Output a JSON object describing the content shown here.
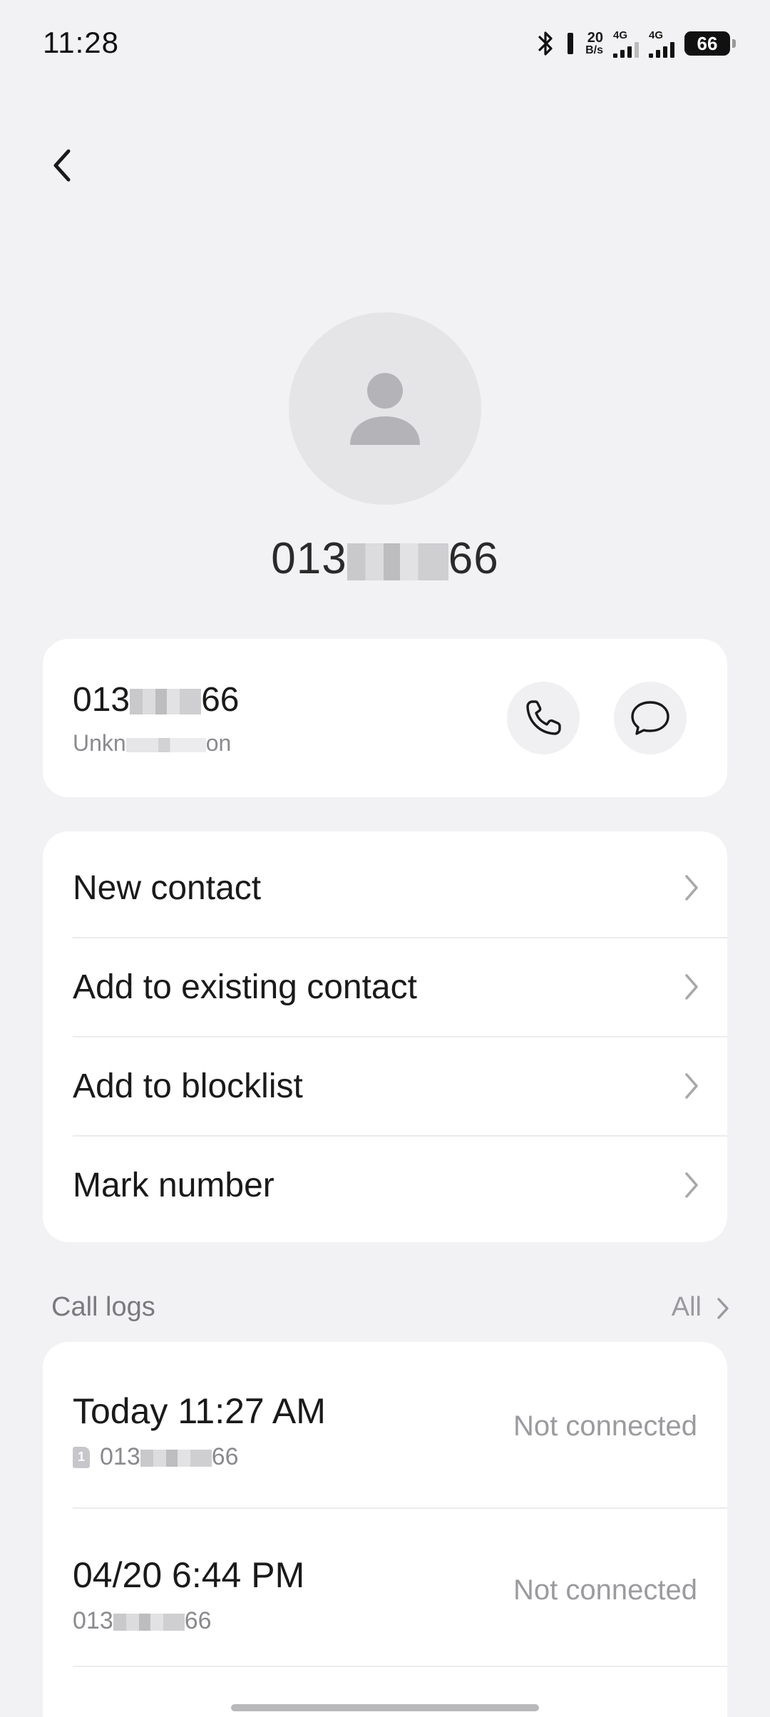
{
  "status_bar": {
    "time": "11:28",
    "net_speed_value": "20",
    "net_speed_unit": "B/s",
    "sim1_network": "4G",
    "sim2_network": "4G",
    "battery": "66"
  },
  "header": {
    "number_display": "013",
    "number_suffix": "66"
  },
  "number_card": {
    "number_prefix": "013",
    "number_suffix": "66",
    "location_prefix": "Unkn",
    "location_suffix": "on"
  },
  "actions": [
    {
      "label": "New contact"
    },
    {
      "label": "Add to existing contact"
    },
    {
      "label": "Add to blocklist"
    },
    {
      "label": "Mark number"
    }
  ],
  "call_logs": {
    "title": "Call logs",
    "all_label": "All",
    "entries": [
      {
        "time": "Today 11:27 AM",
        "sim": "1",
        "number_prefix": "013",
        "number_suffix": "66",
        "status": "Not connected"
      },
      {
        "time": "04/20 6:44 PM",
        "number_prefix": "013",
        "number_suffix": "66",
        "status": "Not connected"
      }
    ]
  },
  "colors": {
    "background": "#f2f2f4",
    "card": "#ffffff",
    "primary_text": "#1a1a1a",
    "secondary_text": "#8a8a8e"
  }
}
